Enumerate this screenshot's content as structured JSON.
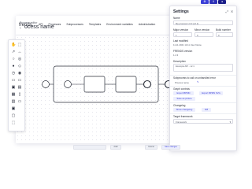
{
  "app": {
    "logo": "frends."
  },
  "nav": {
    "items": [
      "API",
      "Processes",
      "Subprocesses",
      "Templates",
      "Environment variables",
      "Administration"
    ]
  },
  "breadcrumb": "Process editor",
  "process_name": "ocess name",
  "settings": {
    "title": "Settings",
    "name_label": "Name",
    "name_value": "My process 1.0.0 (v2.1)",
    "major_label": "Major version",
    "minor_label": "Minor version",
    "build_label": "Build number",
    "major_value": "1",
    "minor_value": "0",
    "build_value": "0",
    "last_modified_label": "Last modified",
    "last_modified_value": "11.11.2021 11:11   User Name",
    "fremeid_label": "FRENDS version",
    "fremeid_value": "1.2.3",
    "description_label": "Description",
    "description_value": "Example API - v2.1",
    "subprocess_label": "Subprocess to call on unhandled error",
    "subprocess_value": "Process name",
    "graph_label": "Graph controls",
    "export_bpmn": "Export BPMN",
    "export_svg": "Export BPMN SVG",
    "save_button": "Save as picture",
    "changelog_label": "Changelog",
    "changelog_button": "Show changelog",
    "diff_button": "Diff",
    "target_label": "Target framework",
    "target_value": "Framework"
  },
  "footer": {
    "search_placeholder": "",
    "cancel": "Cancel",
    "save": "Save changes"
  },
  "stage_label": "draft"
}
